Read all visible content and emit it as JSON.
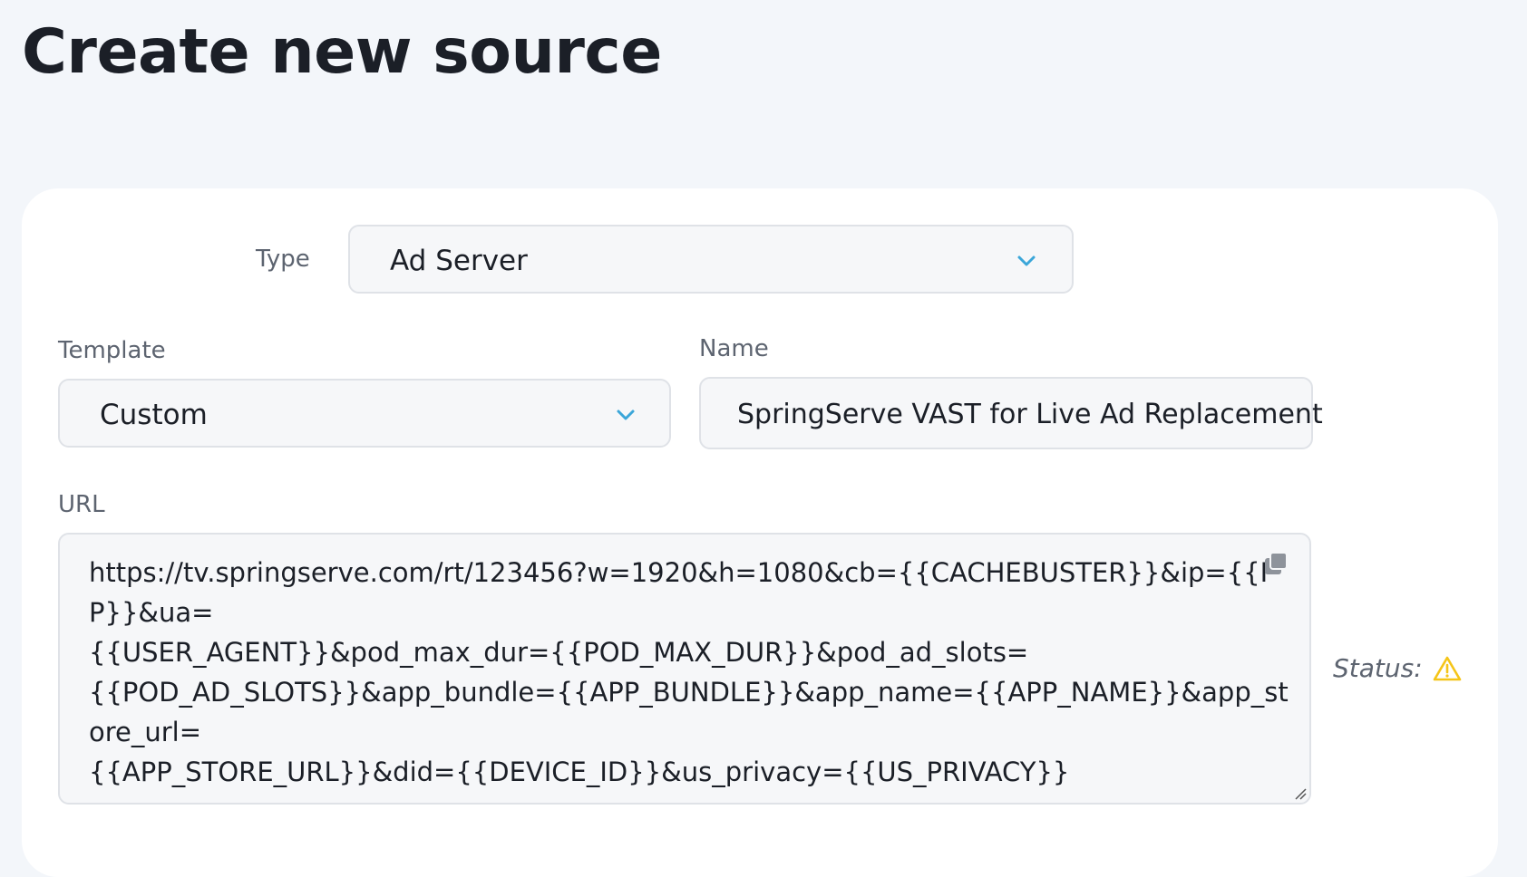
{
  "page": {
    "title": "Create new source"
  },
  "form": {
    "type": {
      "label": "Type",
      "value": "Ad Server",
      "icon": "chevron-down-icon"
    },
    "template": {
      "label": "Template",
      "value": "Custom",
      "icon": "chevron-down-icon"
    },
    "name": {
      "label": "Name",
      "value": "SpringServe VAST for Live Ad Replacement"
    },
    "url": {
      "label": "URL",
      "lines": [
        "https://tv.springserve.com/rt/123456?w=1920&h=1080&cb={{CACHEBUSTER}}&ip={{IP}}&ua=",
        "{{USER_AGENT}}&pod_max_dur={{POD_MAX_DUR}}&pod_ad_slots=",
        "{{POD_AD_SLOTS}}&app_bundle={{APP_BUNDLE}}&app_name={{APP_NAME}}&app_store_url=",
        "{{APP_STORE_URL}}&did={{DEVICE_ID}}&us_privacy={{US_PRIVACY}}"
      ],
      "copy_icon": "copy-icon"
    },
    "status": {
      "label": "Status:",
      "icon": "warning-icon"
    }
  },
  "colors": {
    "background": "#f3f6fa",
    "card": "#ffffff",
    "field_bg": "#f6f7f9",
    "field_border": "#dfe2e7",
    "accent": "#3ba6d9",
    "warning": "#f5c518",
    "title": "#1b1f27",
    "label": "#5d6470"
  }
}
